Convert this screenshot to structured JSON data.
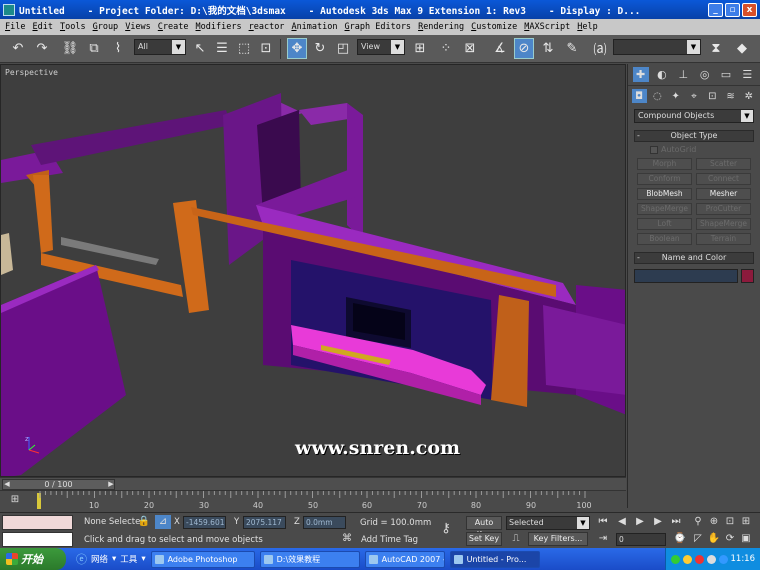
{
  "window": {
    "title": "Untitled    - Project Folder: D:\\我的文档\\3dsmax    - Autodesk 3ds Max 9 Extension 1: Rev3    - Display : D...",
    "min": "_",
    "max": "▫",
    "close": "x"
  },
  "menu": [
    "File",
    "Edit",
    "Tools",
    "Group",
    "Views",
    "Create",
    "Modifiers",
    "reactor",
    "Animation",
    "Graph Editors",
    "Rendering",
    "Customize",
    "MAXScript",
    "Help"
  ],
  "toolbar": {
    "selection_filter": "All",
    "coord_system": "View",
    "named_selection": ""
  },
  "viewport": {
    "label": "Perspective",
    "axis_label": "z"
  },
  "command_panel": {
    "category": "Compound Objects",
    "object_type_title": "Object Type",
    "autogrid": "AutoGrid",
    "buttons": [
      "Morph",
      "Scatter",
      "Conform",
      "Connect",
      "BlobMesh",
      "Mesher",
      "ShapeMerge",
      "ProCutter",
      "Loft",
      "ShapeMerge",
      "Boolean",
      "Terrain"
    ],
    "name_color_title": "Name and Color"
  },
  "timeline": {
    "slider_label": "0 / 100",
    "ticks": [
      "10",
      "20",
      "30",
      "40",
      "50",
      "60",
      "70",
      "80",
      "90",
      "100"
    ]
  },
  "status": {
    "selection": "None Selecte",
    "x_label": "X",
    "x_value": "-1459.601",
    "y_label": "Y",
    "y_value": "2075.117",
    "z_label": "Z",
    "z_value": "0.0mm",
    "grid": "Grid = 100.0mm",
    "prompt": "Click and drag to select and move objects",
    "add_time_tag": "Add Time Tag",
    "auto_key": "Auto Key",
    "set_key": "Set Key",
    "key_mode": "Selected",
    "key_filters": "Key Filters...",
    "frame": "0"
  },
  "taskbar": {
    "start": "开始",
    "network": "网络",
    "tools": "工具",
    "items": [
      "Adobe Photoshop",
      "D:\\效果教程",
      "AutoCAD 2007 - ...",
      "Untitled    - Pro..."
    ],
    "clock": "11:16"
  },
  "watermark": "www.snren.com"
}
